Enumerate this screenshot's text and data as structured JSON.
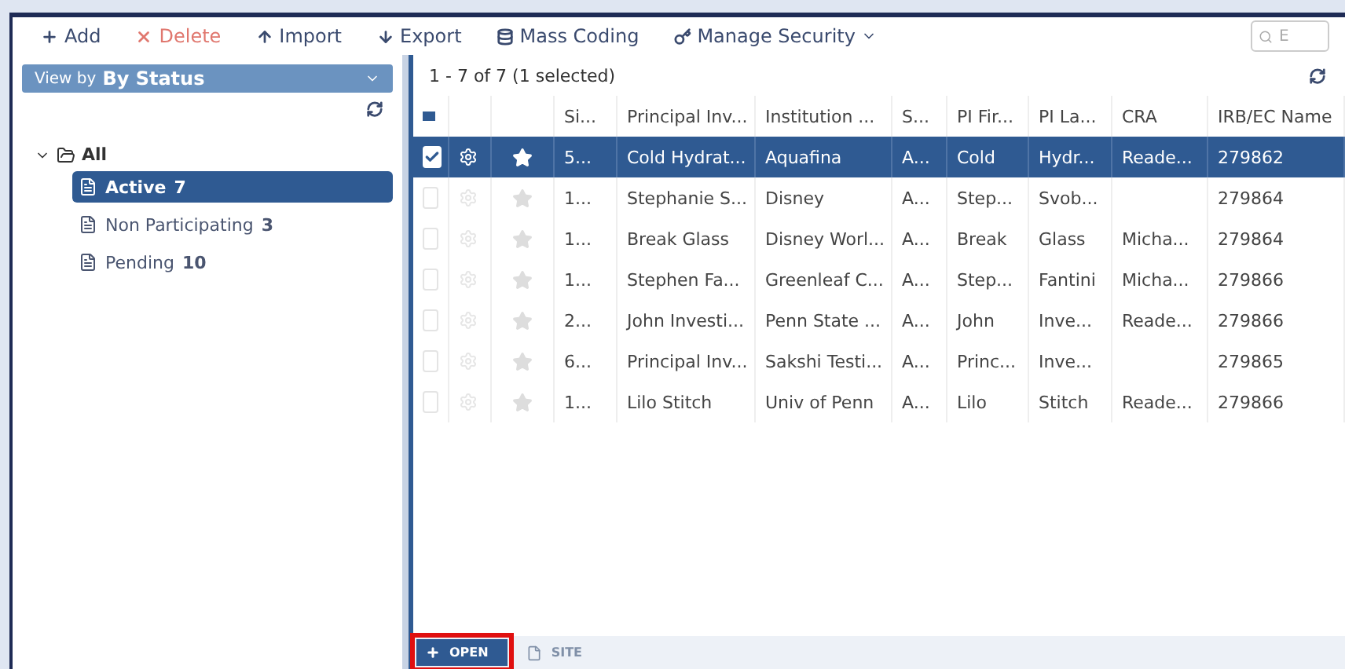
{
  "toolbar": [
    {
      "kind": "add",
      "label": "Add"
    },
    {
      "kind": "delete",
      "label": "Delete"
    },
    {
      "kind": "import",
      "label": "Import"
    },
    {
      "kind": "export",
      "label": "Export"
    },
    {
      "kind": "coding",
      "label": "Mass Coding"
    },
    {
      "kind": "security",
      "label": "Manage Security"
    }
  ],
  "search": {
    "placeholder": "E"
  },
  "view_by": {
    "prefix": "View by",
    "value": "By Status"
  },
  "tree": {
    "label": "All",
    "expanded": true,
    "children": [
      {
        "label": "Active",
        "count": "7",
        "selected": true
      },
      {
        "label": "Non Participating",
        "count": "3",
        "selected": false
      },
      {
        "label": "Pending",
        "count": "10",
        "selected": false
      }
    ]
  },
  "grid": {
    "summary": "1 - 7 of 7 (1 selected)",
    "select_all_partial": true,
    "columns": [
      "Si...",
      "Principal Inv...",
      "Institution ...",
      "S...",
      "PI Fir...",
      "PI La...",
      "CRA",
      "IRB/EC Name"
    ],
    "rows": [
      {
        "selected": true,
        "cells": [
          "5...",
          "Cold Hydrat...",
          "Aquafina",
          "A...",
          "Cold",
          "Hydr...",
          "Reade...",
          "279862"
        ]
      },
      {
        "selected": false,
        "cells": [
          "1...",
          "Stephanie S...",
          "Disney",
          "A...",
          "Step...",
          "Svob...",
          "",
          "279864"
        ]
      },
      {
        "selected": false,
        "cells": [
          "1...",
          "Break Glass",
          "Disney Worl...",
          "A...",
          "Break",
          "Glass",
          "Micha...",
          "279864"
        ]
      },
      {
        "selected": false,
        "cells": [
          "1...",
          "Stephen Fa...",
          "Greenleaf C...",
          "A...",
          "Step...",
          "Fantini",
          "Micha...",
          "279866"
        ]
      },
      {
        "selected": false,
        "cells": [
          "2...",
          "John Investi...",
          "Penn State ...",
          "A...",
          "John",
          "Inve...",
          "Reade...",
          "279866"
        ]
      },
      {
        "selected": false,
        "cells": [
          "6...",
          "Principal Inv...",
          "Sakshi Testi...",
          "A...",
          "Princ...",
          "Inve...",
          "",
          "279865"
        ]
      },
      {
        "selected": false,
        "cells": [
          "1...",
          "Lilo Stitch",
          "Univ of Penn",
          "A...",
          "Lilo",
          "Stitch",
          "Reade...",
          "279866"
        ]
      }
    ]
  },
  "bottom_tabs": [
    {
      "label": "OPEN",
      "selected": true
    },
    {
      "label": "SITE",
      "selected": false
    }
  ]
}
